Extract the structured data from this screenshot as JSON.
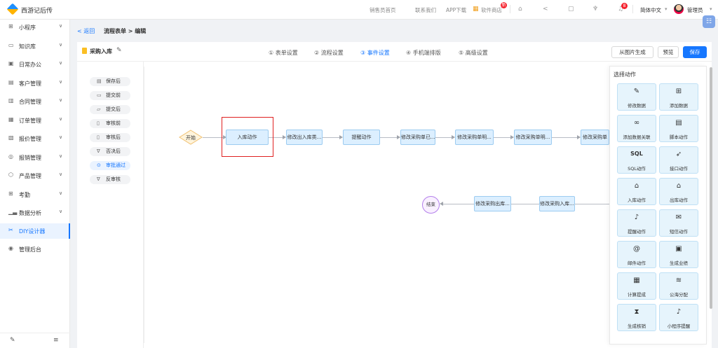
{
  "topbar": {
    "brand": "西游记后传",
    "links": [
      "销售员首页",
      "联系我们",
      "APP下载",
      "软件商店"
    ],
    "store_badge": "新",
    "bell_badge": "8",
    "language": "简体中文",
    "user": "管理员"
  },
  "sidebar": {
    "items": [
      {
        "label": "小程序",
        "icon": "grid-icon"
      },
      {
        "label": "知识库",
        "icon": "book-icon"
      },
      {
        "label": "日常办公",
        "icon": "briefcase-icon"
      },
      {
        "label": "客户管理",
        "icon": "customer-icon"
      },
      {
        "label": "合同管理",
        "icon": "contract-icon"
      },
      {
        "label": "订单管理",
        "icon": "order-icon"
      },
      {
        "label": "报价管理",
        "icon": "quote-icon"
      },
      {
        "label": "报销管理",
        "icon": "reimburse-icon"
      },
      {
        "label": "产品管理",
        "icon": "product-icon"
      },
      {
        "label": "考勤",
        "icon": "attendance-icon"
      },
      {
        "label": "数据分析",
        "icon": "chart-icon"
      },
      {
        "label": "DIY设计器",
        "icon": "designer-icon"
      },
      {
        "label": "管理后台",
        "icon": "admin-icon"
      }
    ]
  },
  "header": {
    "back": "< 返回",
    "breadcrumb": "流程表单 > 编辑",
    "title": "采购入库",
    "steps": [
      "① 表单设置",
      "② 流程设置",
      "③ 事件设置",
      "④ 手机端排版",
      "⑤ 高级设置"
    ],
    "active_step": 2,
    "btn_image": "从图片生成",
    "btn_preview": "预览",
    "btn_save": "保存"
  },
  "events": [
    {
      "label": "保存后",
      "icon": "save-icon"
    },
    {
      "label": "提交前",
      "icon": "folder-icon"
    },
    {
      "label": "提交后",
      "icon": "folder-open-icon"
    },
    {
      "label": "审核前",
      "icon": "clipboard-icon"
    },
    {
      "label": "审核后",
      "icon": "clipboard-check-icon"
    },
    {
      "label": "否决后",
      "icon": "thumb-down-icon"
    },
    {
      "label": "审批通过",
      "icon": "check-circle-icon",
      "active": true
    },
    {
      "label": "反审核",
      "icon": "thumb-down-icon"
    }
  ],
  "flow": {
    "start": "开始",
    "end": "结束",
    "row1": [
      "入库动作",
      "修改出入库类...",
      "提醒动作",
      "修改采购单已...",
      "修改采购单明...",
      "修改采购单明...",
      "修改采购单"
    ],
    "row2": [
      "修改采购入库...",
      "修改采购出库..."
    ]
  },
  "actions": {
    "title": "选择动作",
    "items": [
      {
        "label": "修改数据",
        "icon": "edit-icon"
      },
      {
        "label": "添加数据",
        "icon": "plus-box-icon"
      },
      {
        "label": "添加数据关联",
        "icon": "link-icon"
      },
      {
        "label": "脚本动作",
        "icon": "script-icon"
      },
      {
        "label": "SQL动作",
        "icon": "sql-icon"
      },
      {
        "label": "接口动作",
        "icon": "rocket-icon"
      },
      {
        "label": "入库动作",
        "icon": "warehouse-in-icon"
      },
      {
        "label": "出库动作",
        "icon": "warehouse-out-icon"
      },
      {
        "label": "提醒动作",
        "icon": "bell-icon"
      },
      {
        "label": "短信动作",
        "icon": "mail-icon"
      },
      {
        "label": "邮件动作",
        "icon": "at-icon"
      },
      {
        "label": "生成业绩",
        "icon": "performance-icon"
      },
      {
        "label": "计算提成",
        "icon": "calculator-icon"
      },
      {
        "label": "公海分配",
        "icon": "waves-icon"
      },
      {
        "label": "生成核销",
        "icon": "hourglass-icon"
      },
      {
        "label": "小程序提醒",
        "icon": "mini-bell-icon"
      }
    ]
  }
}
